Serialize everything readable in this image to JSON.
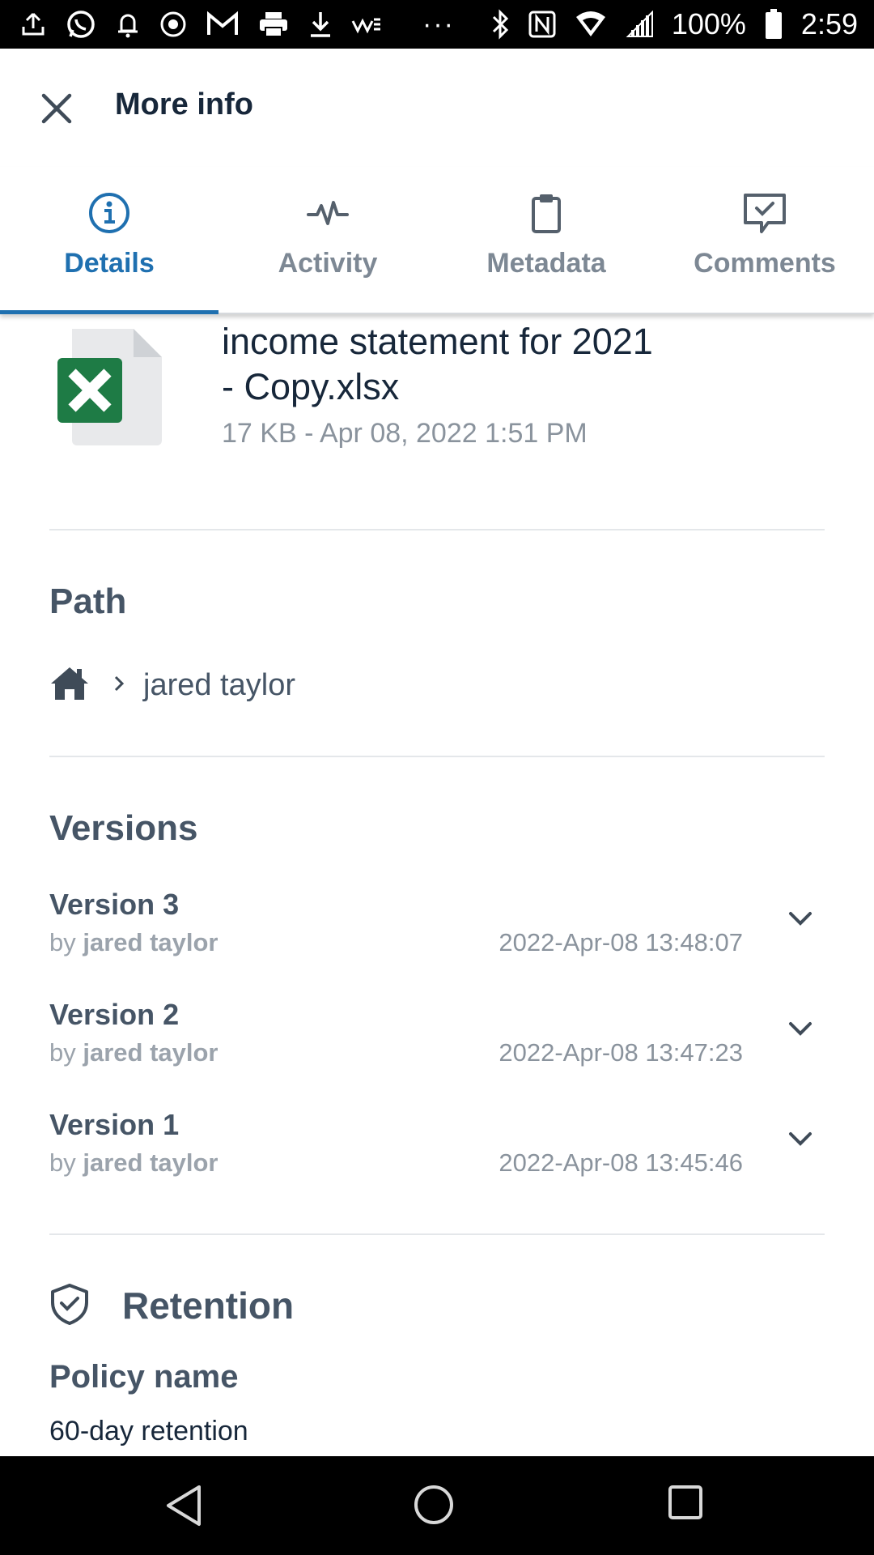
{
  "status_bar": {
    "battery": "100%",
    "time": "2:59",
    "more": "···",
    "icons": [
      "upload-icon",
      "whatsapp-icon",
      "bell-icon",
      "record-icon",
      "gmail-icon",
      "printer-icon",
      "download-icon",
      "carrier-icon",
      "bluetooth-icon",
      "nfc-icon",
      "wifi-icon",
      "signal-icon",
      "battery-icon"
    ]
  },
  "header": {
    "title": "More info"
  },
  "tabs": [
    {
      "label": "Details",
      "icon": "info-icon",
      "active": true
    },
    {
      "label": "Activity",
      "icon": "pulse-icon",
      "active": false
    },
    {
      "label": "Metadata",
      "icon": "clipboard-icon",
      "active": false
    },
    {
      "label": "Comments",
      "icon": "comment-check-icon",
      "active": false
    }
  ],
  "file": {
    "name_line1": "income statement for 2021",
    "name_line2": "- Copy.xlsx",
    "meta": "17 KB - Apr 08, 2022 1:51 PM",
    "icon": "excel-file-icon"
  },
  "path": {
    "title": "Path",
    "crumb": "jared taylor"
  },
  "versions": {
    "title": "Versions",
    "by_prefix": "by",
    "items": [
      {
        "label": "Version 3",
        "author": "jared taylor",
        "date": "2022-Apr-08 13:48:07"
      },
      {
        "label": "Version 2",
        "author": "jared taylor",
        "date": "2022-Apr-08 13:47:23"
      },
      {
        "label": "Version 1",
        "author": "jared taylor",
        "date": "2022-Apr-08 13:45:46"
      }
    ]
  },
  "retention": {
    "title": "Retention",
    "policy_label": "Policy name",
    "policy_value": "60-day retention"
  },
  "colors": {
    "accent": "#1f70b0",
    "heading": "#465566",
    "muted": "#8a939d",
    "excel_green": "#1e7b45"
  }
}
